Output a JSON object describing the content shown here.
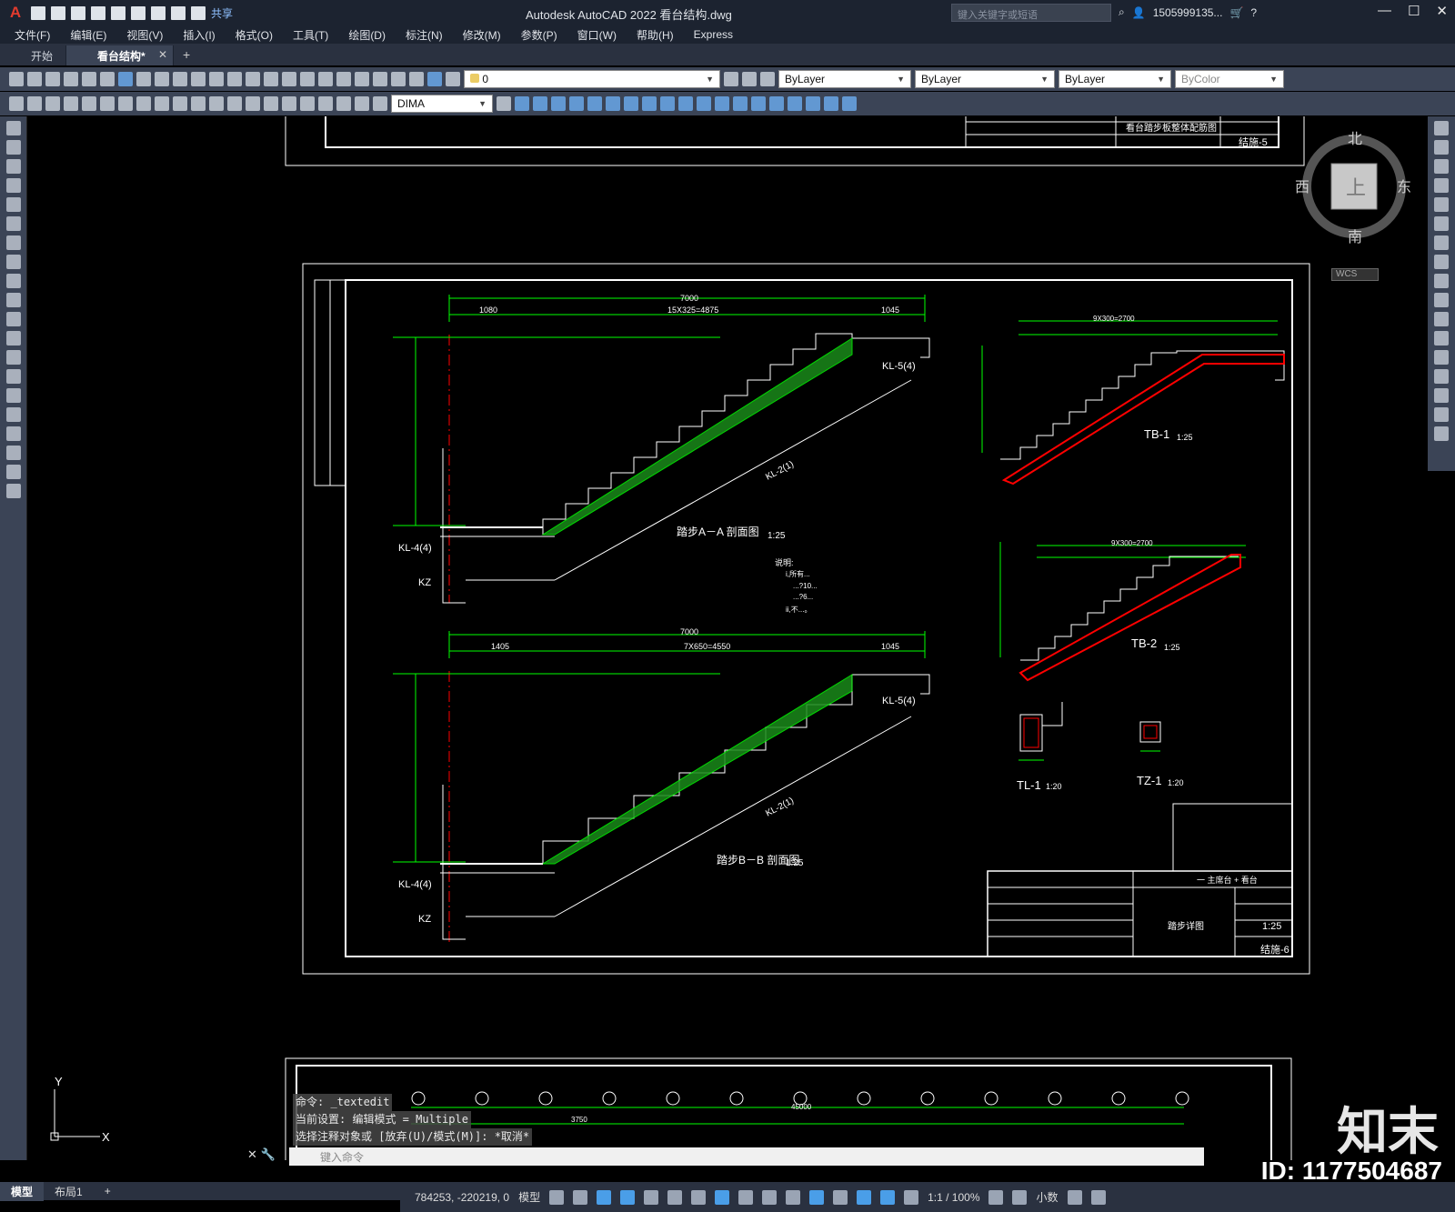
{
  "app": {
    "logo": "A",
    "title": "Autodesk AutoCAD 2022    看台结构.dwg",
    "share": "共享",
    "search_placeholder": "键入关键字或短语",
    "user": "1505999135...",
    "window_controls": [
      "—",
      "☐",
      "✕"
    ]
  },
  "menu": [
    "文件(F)",
    "编辑(E)",
    "视图(V)",
    "插入(I)",
    "格式(O)",
    "工具(T)",
    "绘图(D)",
    "标注(N)",
    "修改(M)",
    "参数(P)",
    "窗口(W)",
    "帮助(H)",
    "Express"
  ],
  "tabs": [
    {
      "label": "开始"
    },
    {
      "label": "看台结构*"
    }
  ],
  "toolbar": {
    "layer": "0",
    "color": "ByLayer",
    "linetype": "ByLayer",
    "lineweight": "ByLayer",
    "plotstyle": "ByColor",
    "dimstyle": "DIMA"
  },
  "viewcube": {
    "north": "北",
    "south": "南",
    "east": "东",
    "west": "西",
    "top": "上",
    "wcs": "WCS"
  },
  "drawing": {
    "sectionA": "踏步A－A 剖面图",
    "sectionA_scale": "1:25",
    "sectionB": "踏步B－B 剖面图",
    "sectionB_scale": "1:25",
    "dimA_total": "7000",
    "dimA_left": "1080",
    "dimA_mid": "15X325=4875",
    "dimA_right": "1045",
    "dimB_total": "7000",
    "dimB_left": "1405",
    "dimB_mid": "7X650=4550",
    "dimB_right": "1045",
    "tb1": "TB-1",
    "tb1_scale": "1:25",
    "tb1_dim": "9X300=2700",
    "tb2": "TB-2",
    "tb2_scale": "1:25",
    "tb2_dim": "9X300=2700",
    "tl1": "TL-1",
    "tl1_scale": "1:20",
    "tz1": "TZ-1",
    "tz1_scale": "1:20",
    "kl4": "KL-4(4)",
    "kl5": "KL-5(4)",
    "kl2": "KL-2(1)",
    "kz": "KZ",
    "notes_title": "说明:",
    "notes": [
      "i,所有...",
      "...?10...",
      "...?6...",
      "ii,不...。"
    ],
    "title_project": "一 主席台 + 看台",
    "title_sheet": "踏步详图",
    "title_no": "结施-6",
    "title_scale": "1:25",
    "top_sheet_title": "看台踏步板整体配筋图",
    "top_sheet_no": "结施-5",
    "grid_dim": "45000",
    "grid_span": "3750"
  },
  "command": {
    "lines": [
      "命令: _textedit",
      "当前设置: 编辑模式 = Multiple",
      "选择注释对象或 [放弃(U)/模式(M)]: *取消*"
    ],
    "input_placeholder": "键入命令"
  },
  "layout_tabs": [
    "模型",
    "布局1",
    "+"
  ],
  "status": {
    "coords": "784253, -220219, 0",
    "model": "模型",
    "scale": "1:1 / 100%",
    "units": "小数"
  },
  "watermark": {
    "logo": "知末",
    "id": "ID: 1177504687"
  }
}
